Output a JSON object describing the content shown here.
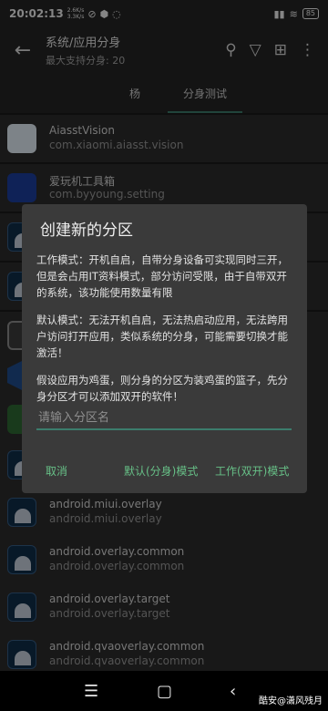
{
  "status_bar": {
    "time": "20:02:13",
    "net_up": "2.6K/s",
    "net_down": "3.3K/s",
    "battery": "85"
  },
  "header": {
    "title": "系统/应用分身",
    "subtitle": "最大支持分身: 20",
    "icons": [
      "back-arrow-icon",
      "search-icon",
      "filter-icon",
      "add-icon",
      "more-icon"
    ]
  },
  "tabs": [
    {
      "label": "杨"
    },
    {
      "label": "分身测试",
      "selected": true
    }
  ],
  "apps": [
    {
      "name": "AiasstVision",
      "package": "com.xiaomi.aiasst.vision",
      "icon": "vision-icon"
    },
    {
      "name": "爱玩机工具箱",
      "package": "com.byyoung.setting",
      "icon": "toolbox-icon"
    },
    {
      "name": "",
      "package": "",
      "icon": "android-icon"
    },
    {
      "name": "",
      "package": "",
      "icon": "android-icon"
    },
    {
      "name": "",
      "package": "",
      "icon": "round-app-icon"
    },
    {
      "name": "",
      "package": "",
      "icon": "hex-app-icon"
    },
    {
      "name": "",
      "package": "",
      "icon": "green-app-icon"
    },
    {
      "name": "",
      "package": "",
      "icon": "android-icon"
    },
    {
      "name": "android.miui.overlay",
      "package": "android.miui.overlay",
      "icon": "android-icon"
    },
    {
      "name": "android.overlay.common",
      "package": "android.overlay.common",
      "icon": "android-icon"
    },
    {
      "name": "android.overlay.target",
      "package": "android.overlay.target",
      "icon": "android-icon"
    },
    {
      "name": "android.qvaoverlay.common",
      "package": "android.qvaoverlay.common",
      "icon": "android-icon"
    }
  ],
  "dialog": {
    "title": "创建新的分区",
    "paragraphs": [
      "工作模式：开机自启，自带分身设备可实现同时三开，但是会占用IT资料模式，部分访问受限，由于自带双开的系统，该功能使用数量有限",
      "默认模式：无法开机自启，无法热启动应用，无法跨用户访问打开应用，类似系统的分身，可能需要切换才能激活！",
      "假设应用为鸡蛋，则分身的分区为装鸡蛋的篮子，先分身分区才可以添加双开的软件！"
    ],
    "input_placeholder": "请输入分区名",
    "input_value": "",
    "buttons": {
      "cancel": "取消",
      "default_mode": "默认(分身)模式",
      "work_mode": "工作(双开)模式"
    }
  },
  "watermark": "酷安@潇风残月",
  "colors": {
    "accent": "#3c7d6c",
    "button_text": "#67c087",
    "dialog_bg": "#3a3a3a",
    "list_row_bg": "#2c2c2c"
  }
}
